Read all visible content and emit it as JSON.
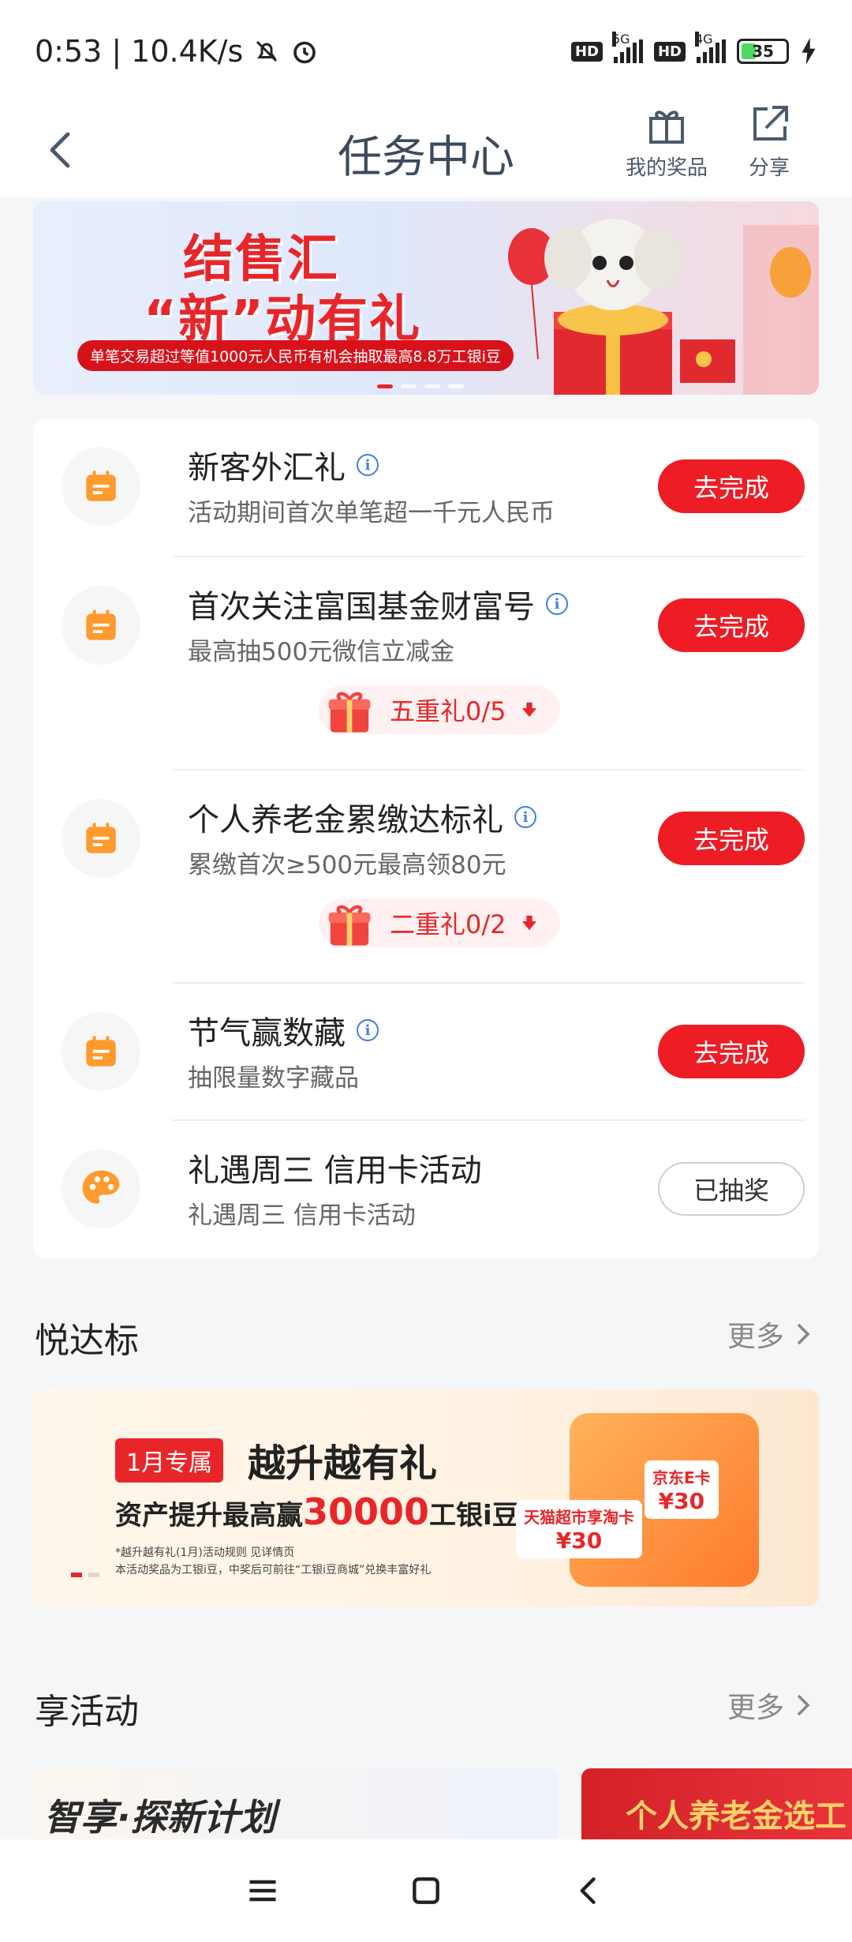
{
  "status_bar": {
    "time": "0:53",
    "network_speed": "10.4K/s",
    "sim1_type": "5G",
    "sim2_type": "4G",
    "hd_label": "HD",
    "battery": "35"
  },
  "header": {
    "title": "任务中心",
    "my_prizes_label": "我的奖品",
    "share_label": "分享"
  },
  "banner": {
    "title_line1": "结售汇",
    "title_line2": "“新”动有礼",
    "subtitle": "单笔交易超过等值1000元人民币有机会抽取最高8.8万工银i豆"
  },
  "tasks": [
    {
      "title": "新客外汇礼",
      "desc": "活动期间首次单笔超一千元人民币",
      "button": "去完成"
    },
    {
      "title": "首次关注富国基金财富号",
      "desc": "最高抽500元微信立减金",
      "button": "去完成",
      "gift": "五重礼0/5"
    },
    {
      "title": "个人养老金累缴达标礼",
      "desc": "累缴首次≥500元最高领80元",
      "button": "去完成",
      "gift": "二重礼0/2"
    },
    {
      "title": "节气赢数藏",
      "desc": "抽限量数字藏品",
      "button": "去完成"
    },
    {
      "title": "礼遇周三 信用卡活动",
      "desc": "礼遇周三 信用卡活动",
      "button": "已抽奖"
    }
  ],
  "section_yuedabiao": {
    "title": "悦达标",
    "more": "更多"
  },
  "promo": {
    "tag": "1月专属",
    "headline": "越升越有礼",
    "line_prefix": "资产提升最高赢",
    "line_number": "30000",
    "line_suffix": "工银i豆",
    "note1": "*越升越有礼(1月)活动规则 见详情页",
    "note2": "本活动奖品为工银i豆，中奖后可前往“工银i豆商城”兑换丰富好礼",
    "card1_name": "京东E卡",
    "card1_value": "¥30",
    "card2_name": "天猫超市享淘卡",
    "card2_value": "¥30"
  },
  "section_xianghuodong": {
    "title": "享活动",
    "more": "更多"
  },
  "activity_cards": {
    "card1_text": "智享·探新计划",
    "card2_text": "个人养老金选工"
  },
  "colors": {
    "accent_red": "#ee1c25",
    "icon_orange": "#ff9a2e"
  }
}
